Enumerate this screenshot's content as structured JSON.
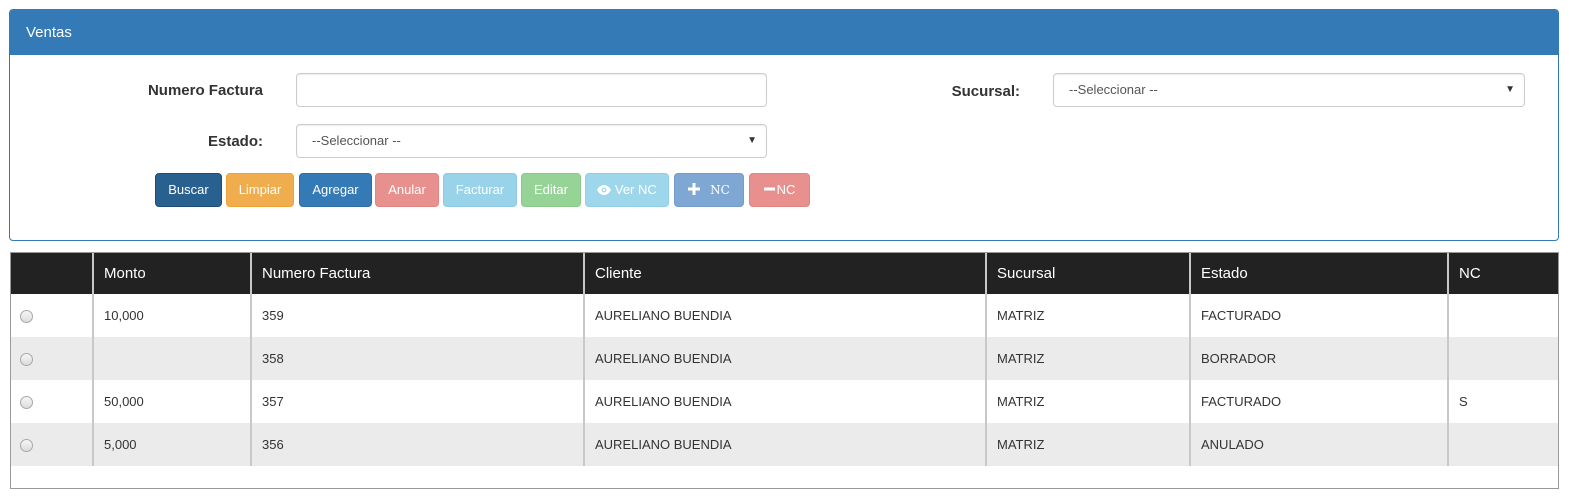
{
  "panel": {
    "title": "Ventas"
  },
  "form": {
    "numero_factura_label": "Numero Factura",
    "numero_factura_value": "",
    "sucursal_label": "Sucursal:",
    "sucursal_value": "--Seleccionar --",
    "estado_label": "Estado:",
    "estado_value": "--Seleccionar --",
    "caret": "▼"
  },
  "buttons": {
    "buscar": "Buscar",
    "limpiar": "Limpiar",
    "agregar": "Agregar",
    "anular": "Anular",
    "facturar": "Facturar",
    "editar": "Editar",
    "ver_nc": "Ver NC",
    "add_nc": "NC",
    "remove_nc": "NC"
  },
  "icons": {
    "eye": "eye-icon",
    "plus": "plus-icon",
    "minus": "minus-icon"
  },
  "colors": {
    "primary": "#337ab7",
    "primary_dark": "#286090",
    "warning": "#f0ad4e",
    "danger_light": "#e8908e",
    "info_light": "#98d3ea",
    "success_light": "#96d396",
    "table_header": "#222222",
    "row_alt": "#ebebeb"
  },
  "table": {
    "headers": [
      "",
      "Monto",
      "Numero Factura",
      "Cliente",
      "Sucursal",
      "Estado",
      "NC"
    ],
    "rows": [
      {
        "monto": "10,000",
        "numero": "359",
        "cliente": "AURELIANO BUENDIA",
        "sucursal": "MATRIZ",
        "estado": "FACTURADO",
        "nc": ""
      },
      {
        "monto": "",
        "numero": "358",
        "cliente": "AURELIANO BUENDIA",
        "sucursal": "MATRIZ",
        "estado": "BORRADOR",
        "nc": ""
      },
      {
        "monto": "50,000",
        "numero": "357",
        "cliente": "AURELIANO BUENDIA",
        "sucursal": "MATRIZ",
        "estado": "FACTURADO",
        "nc": "S"
      },
      {
        "monto": "5,000",
        "numero": "356",
        "cliente": "AURELIANO BUENDIA",
        "sucursal": "MATRIZ",
        "estado": "ANULADO",
        "nc": ""
      }
    ]
  }
}
